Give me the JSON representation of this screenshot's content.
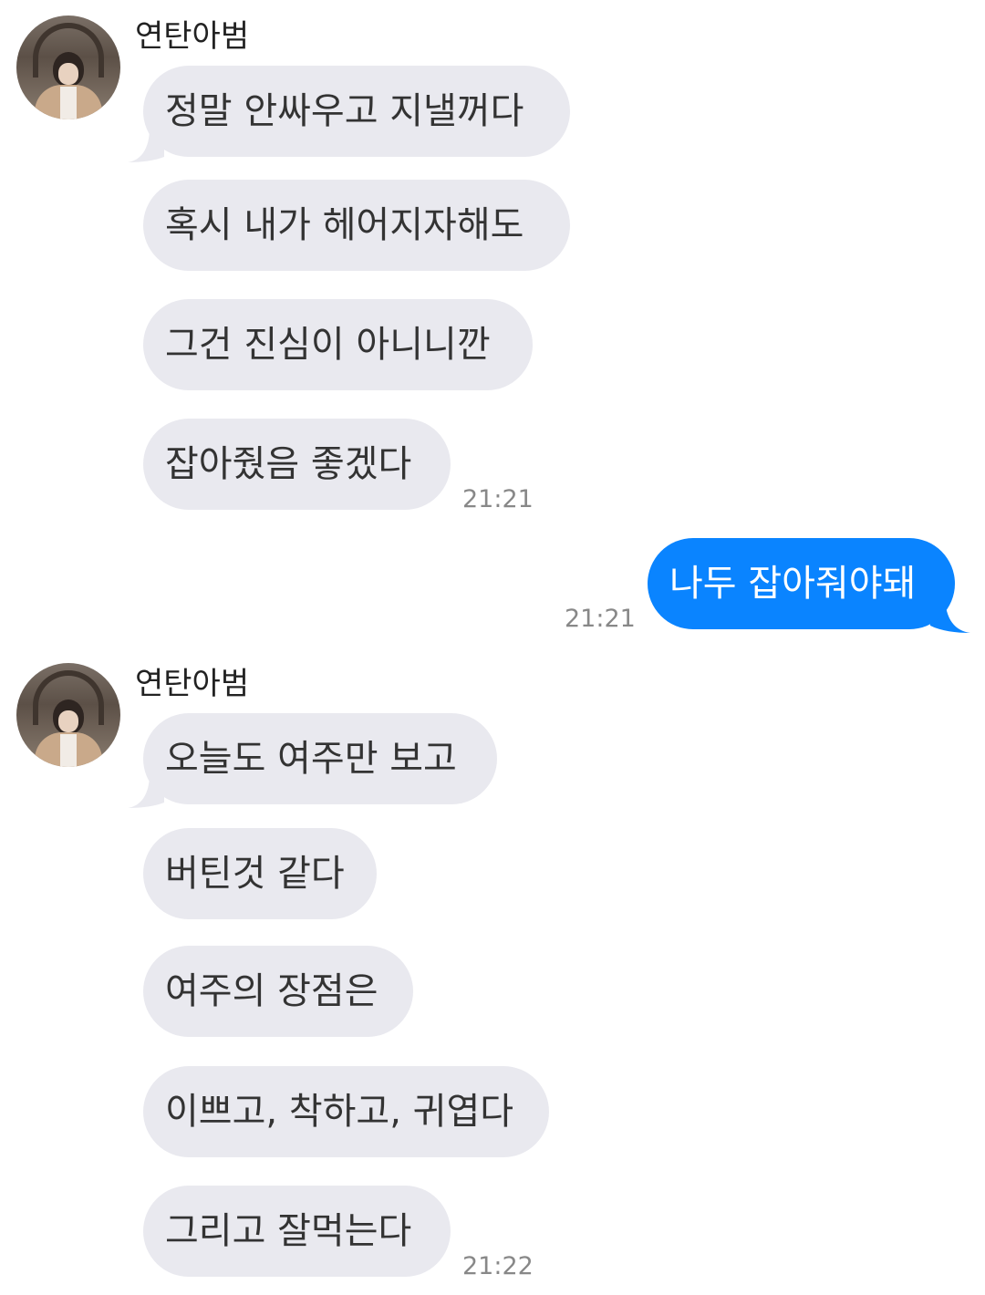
{
  "groups": [
    {
      "sender": "연탄아범",
      "messages": [
        "정말 안싸우고 지낼꺼다",
        "혹시 내가 헤어지자해도",
        "그건 진심이 아니니깐",
        "잡아줬음 좋겠다"
      ],
      "time": "21:21"
    },
    {
      "sender": "me",
      "messages": [
        "나두 잡아줘야돼"
      ],
      "time": "21:21"
    },
    {
      "sender": "연탄아범",
      "messages": [
        "오늘도 여주만 보고",
        "버틴것 같다",
        "여주의 장점은",
        "이쁘고, 착하고, 귀엽다",
        "그리고 잘먹는다"
      ],
      "time": "21:22"
    }
  ],
  "icons": {
    "avatar": "profile-avatar"
  },
  "colors": {
    "incoming_bubble": "#e9e9ef",
    "outgoing_bubble": "#0a84ff",
    "timestamp": "#888888"
  }
}
